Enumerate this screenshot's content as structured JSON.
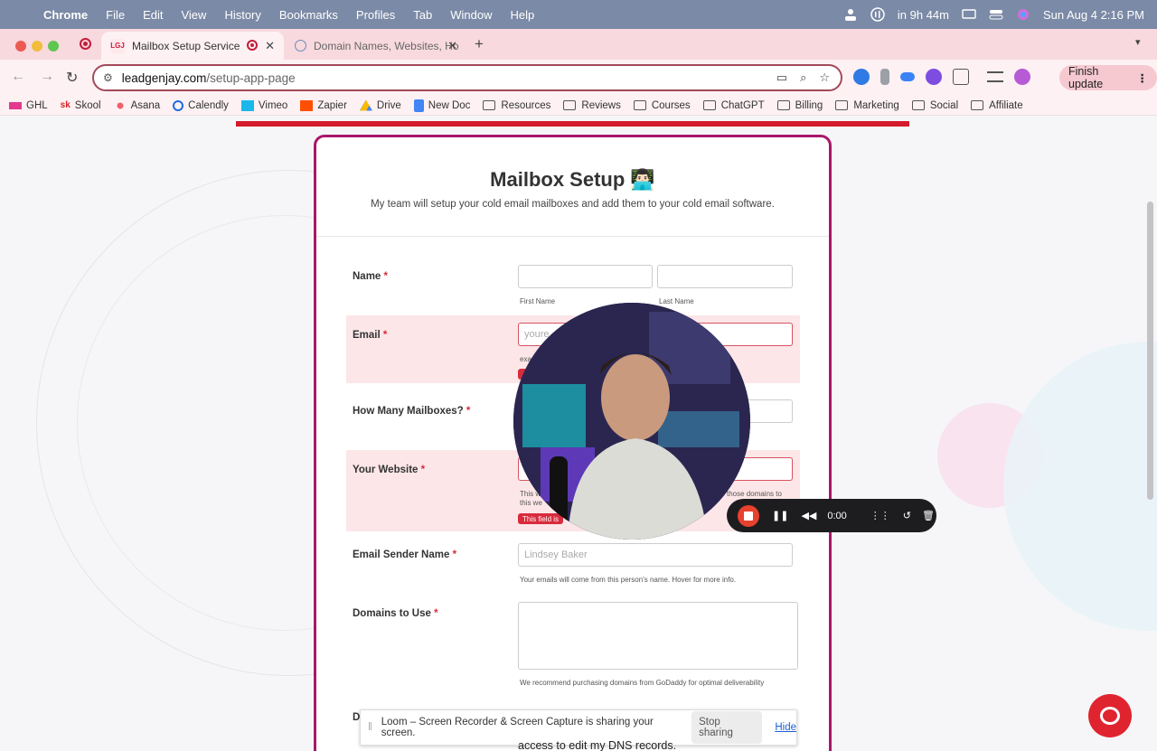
{
  "menubar": {
    "app": "Chrome",
    "items": [
      "File",
      "Edit",
      "View",
      "History",
      "Bookmarks",
      "Profiles",
      "Tab",
      "Window",
      "Help"
    ],
    "status_countdown": "in 9h 44m",
    "datetime": "Sun Aug 4  2:16 PM"
  },
  "tabs": [
    {
      "favicon": "LGJ",
      "title": "Mailbox Setup Service",
      "active": true
    },
    {
      "favicon": "globe-icon",
      "title": "Domain Names, Websites, Ho",
      "active": false
    }
  ],
  "omnibox": {
    "host": "leadgenjay.com",
    "path": "/setup-app-page"
  },
  "toolbar": {
    "finish_update": "Finish update"
  },
  "bookmarks": [
    {
      "label": "GHL",
      "type": "site"
    },
    {
      "label": "Skool",
      "type": "site"
    },
    {
      "label": "Asana",
      "type": "site"
    },
    {
      "label": "Calendly",
      "type": "site"
    },
    {
      "label": "Vimeo",
      "type": "site"
    },
    {
      "label": "Zapier",
      "type": "site"
    },
    {
      "label": "Drive",
      "type": "site"
    },
    {
      "label": "New Doc",
      "type": "site"
    },
    {
      "label": "Resources",
      "type": "folder"
    },
    {
      "label": "Reviews",
      "type": "folder"
    },
    {
      "label": "Courses",
      "type": "folder"
    },
    {
      "label": "ChatGPT",
      "type": "folder"
    },
    {
      "label": "Billing",
      "type": "folder"
    },
    {
      "label": "Marketing",
      "type": "folder"
    },
    {
      "label": "Social",
      "type": "folder"
    },
    {
      "label": "Affiliate",
      "type": "folder"
    }
  ],
  "form": {
    "title": "Mailbox Setup 👨🏻‍💻",
    "subtitle": "My team will setup your cold email mailboxes and add them to your cold email software.",
    "name_label": "Name",
    "first_name_hint": "First Name",
    "last_name_hint": "Last Name",
    "email_label": "Email",
    "email_placeholder": "youre",
    "email_hint": "exa",
    "mailboxes_label": "How Many Mailboxes?",
    "website_label": "Your Website",
    "website_hint": "This w",
    "website_hint_2": "this we",
    "website_hint_right": "those domains to",
    "website_error": "This field is",
    "sender_label": "Email Sender Name",
    "sender_placeholder": "Lindsey Baker",
    "sender_hint": "Your emails will come from this person's name. Hover for more info.",
    "domains_label": "Domains to Use",
    "domains_hint": "We recommend purchasing domains from GoDaddy for optimal deliverability",
    "dns_label_partial": "D",
    "dns_text_partial": "access to edit my DNS records."
  },
  "loom": {
    "timer": "0:00",
    "share_message": "Loom – Screen Recorder & Screen Capture is sharing your screen.",
    "stop_sharing": "Stop sharing",
    "hide": "Hide"
  }
}
